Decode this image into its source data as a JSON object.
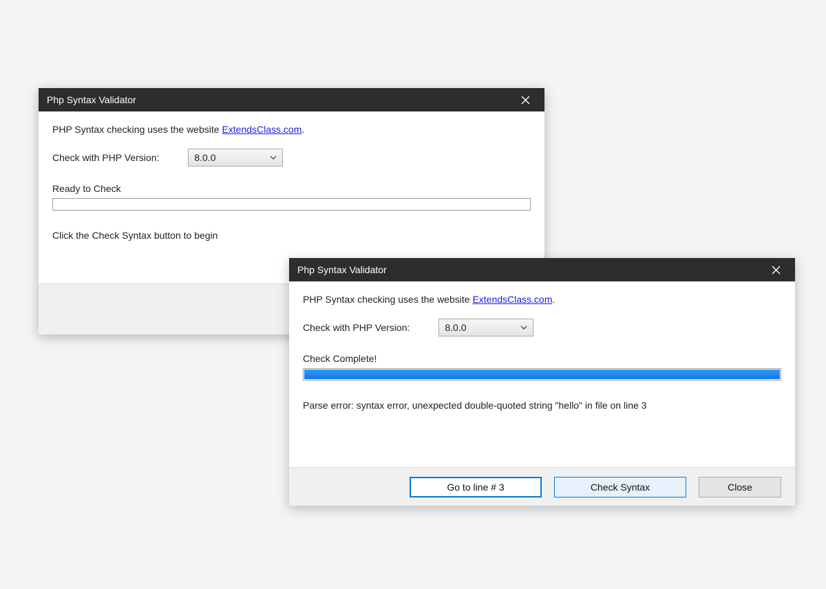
{
  "dialog1": {
    "title": "Php Syntax Validator",
    "info_prefix": "PHP Syntax checking uses the website ",
    "info_link": "ExtendsClass.com",
    "info_suffix": ".",
    "version_label": "Check with PHP Version:",
    "version_value": "8.0.0",
    "status": "Ready to Check",
    "progress_pct": 0,
    "instruction": "Click the Check Syntax button to begin"
  },
  "dialog2": {
    "title": "Php Syntax Validator",
    "info_prefix": "PHP Syntax checking uses the website ",
    "info_link": "ExtendsClass.com",
    "info_suffix": ".",
    "version_label": "Check with PHP Version:",
    "version_value": "8.0.0",
    "status": "Check Complete!",
    "progress_pct": 100,
    "error_msg": "Parse error: syntax error, unexpected double-quoted string \"hello\" in file on line 3",
    "buttons": {
      "goto_line": "Go to line # 3",
      "check_syntax": "Check Syntax",
      "close": "Close"
    }
  }
}
